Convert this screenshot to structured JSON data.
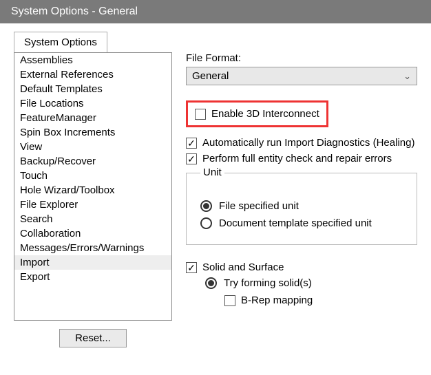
{
  "window": {
    "title": "System Options - General"
  },
  "tab": {
    "label": "System Options"
  },
  "sidebar": {
    "items": [
      "Assemblies",
      "External References",
      "Default Templates",
      "File Locations",
      "FeatureManager",
      "Spin Box Increments",
      "View",
      "Backup/Recover",
      "Touch",
      "Hole Wizard/Toolbox",
      "File Explorer",
      "Search",
      "Collaboration",
      "Messages/Errors/Warnings",
      "Import",
      "Export"
    ],
    "selected": 14
  },
  "reset_label": "Reset...",
  "form": {
    "file_format_label": "File Format:",
    "file_format_value": "General",
    "enable_3d": "Enable 3D Interconnect",
    "auto_diag": "Automatically run Import Diagnostics (Healing)",
    "entity_check": "Perform full entity check and repair errors",
    "unit": {
      "legend": "Unit",
      "file_specified": "File specified unit",
      "doc_template": "Document template specified unit"
    },
    "solid_surface": "Solid and Surface",
    "try_forming": "Try forming solid(s)",
    "brep": "B-Rep mapping"
  }
}
